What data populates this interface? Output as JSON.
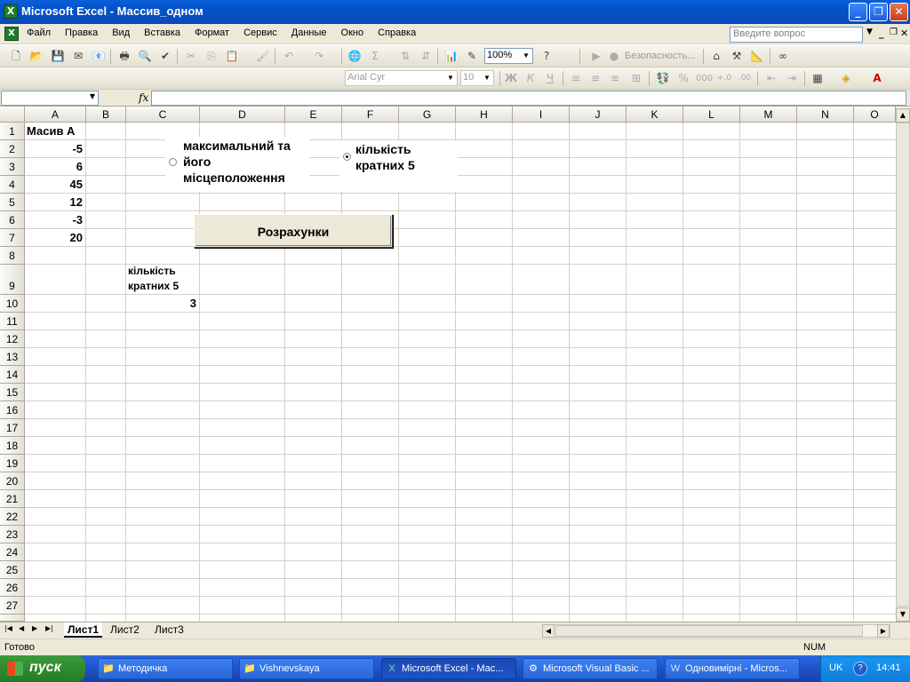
{
  "window": {
    "title": "Microsoft Excel - Массив_одном",
    "app_icon": "excel-icon",
    "controls": {
      "minimize": "_",
      "maximize": "❐",
      "close": "✕"
    }
  },
  "menu": {
    "items": [
      "Файл",
      "Правка",
      "Вид",
      "Вставка",
      "Формат",
      "Сервис",
      "Данные",
      "Окно",
      "Справка"
    ],
    "help_placeholder": "Введите вопрос",
    "mdi": {
      "minimize": "_",
      "restore": "❐",
      "close": "✕"
    }
  },
  "toolbar": {
    "zoom": "100%",
    "security_label": "Безопасность...",
    "font_name": "Arial Cyr",
    "font_size": "10",
    "bold": "Ж",
    "italic": "К",
    "underline": "Ч"
  },
  "formula_bar": {
    "name_box": "",
    "fx": "fx",
    "value": ""
  },
  "sheet": {
    "columns": [
      "A",
      "B",
      "C",
      "D",
      "E",
      "F",
      "G",
      "H",
      "I",
      "J",
      "K",
      "L",
      "M",
      "N",
      "O"
    ],
    "rows": [
      "1",
      "2",
      "3",
      "4",
      "5",
      "6",
      "7",
      "8",
      "9",
      "10",
      "11",
      "12",
      "13",
      "14",
      "15",
      "16",
      "17",
      "18",
      "19",
      "20",
      "21",
      "22",
      "23",
      "24",
      "25",
      "26",
      "27"
    ],
    "cells": {
      "A1": "Масив А",
      "A2": "-5",
      "A3": "6",
      "A4": "45",
      "A5": "12",
      "A6": "-3",
      "A7": "20",
      "C9": "кількість кратних 5",
      "C10": "3"
    }
  },
  "controls": {
    "option1_label": "максимальний та його місцеположення",
    "option1_selected": false,
    "option2_label": "кількість кратних  5",
    "option2_selected": true,
    "button_label": "Розрахунки"
  },
  "sheet_tabs": [
    "Лист1",
    "Лист2",
    "Лист3"
  ],
  "active_tab": "Лист1",
  "status": {
    "left": "Готово",
    "num": "NUM"
  },
  "taskbar": {
    "start_label": "пуск",
    "tasks": [
      {
        "label": "Методичка",
        "icon": "folder-icon"
      },
      {
        "label": "Vishnevskaya",
        "icon": "folder-icon"
      },
      {
        "label": "Microsoft Excel - Мас...",
        "icon": "excel-icon"
      },
      {
        "label": "Microsoft Visual Basic ...",
        "icon": "vba-icon"
      },
      {
        "label": "Одновимірні - Micros...",
        "icon": "word-icon"
      }
    ],
    "lang": "UK",
    "clock": "14:41"
  }
}
